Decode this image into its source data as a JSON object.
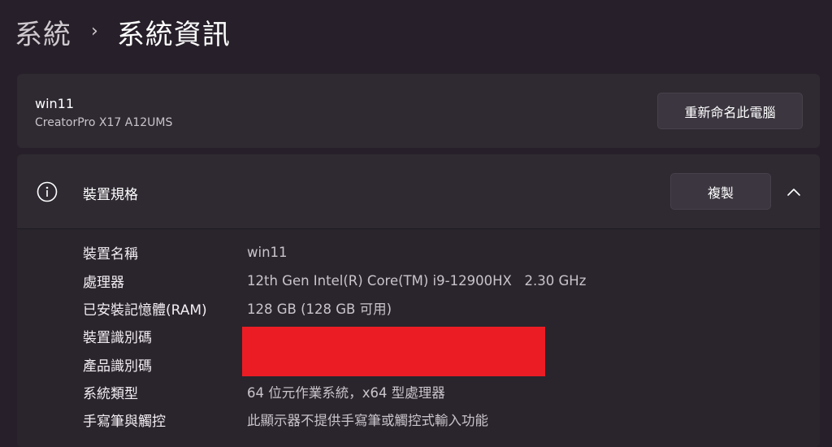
{
  "breadcrumb": {
    "parent": "系統",
    "separator": "›",
    "current": "系統資訊"
  },
  "device_card": {
    "name": "win11",
    "model": "CreatorPro X17 A12UMS",
    "rename_button": "重新命名此電腦"
  },
  "specs": {
    "title": "裝置規格",
    "copy_button": "複製",
    "icons": {
      "info": "info-icon",
      "collapse": "chevron-up-icon"
    },
    "rows": [
      {
        "label": "裝置名稱",
        "value": "win11"
      },
      {
        "label": "處理器",
        "value": "12th Gen Intel(R) Core(TM) i9-12900HX   2.30 GHz"
      },
      {
        "label": "已安裝記憶體(RAM)",
        "value": "128 GB (128 GB 可用)"
      },
      {
        "label": "裝置識別碼",
        "value": ""
      },
      {
        "label": "產品識別碼",
        "value": ""
      },
      {
        "label": "系統類型",
        "value": "64 位元作業系統，x64 型處理器"
      },
      {
        "label": "手寫筆與觸控",
        "value": "此顯示器不提供手寫筆或觸控式輸入功能"
      }
    ]
  },
  "colors": {
    "background": "#27202a",
    "card": "#2f2a32",
    "redaction": "#ec1c24"
  }
}
